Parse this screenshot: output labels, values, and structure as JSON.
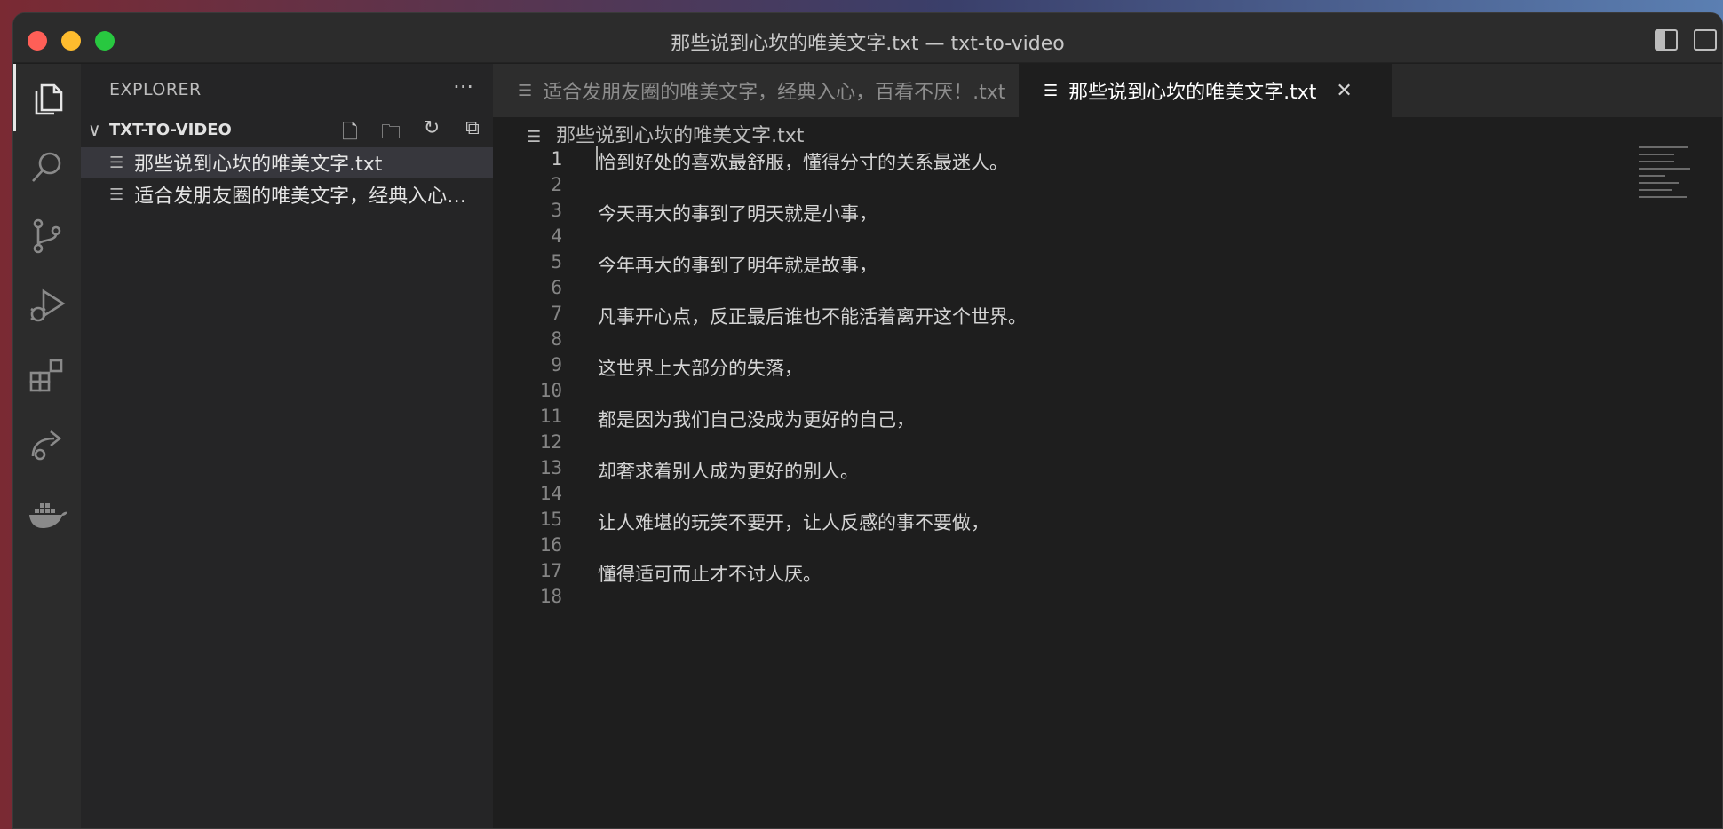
{
  "window": {
    "title": "那些说到心坎的唯美文字.txt — txt-to-video"
  },
  "activity_bar": {
    "items": [
      {
        "name": "explorer-icon",
        "active": true
      },
      {
        "name": "search-icon",
        "active": false
      },
      {
        "name": "source-control-icon",
        "active": false
      },
      {
        "name": "run-debug-icon",
        "active": false
      },
      {
        "name": "extensions-icon",
        "active": false
      },
      {
        "name": "remote-live-share-icon",
        "active": false
      },
      {
        "name": "docker-icon",
        "active": false
      }
    ]
  },
  "sidebar": {
    "header": "EXPLORER",
    "more": "···",
    "folder": {
      "name": "TXT-TO-VIDEO",
      "chevron": "∨",
      "actions": [
        "new-file-icon",
        "new-folder-icon",
        "refresh-icon",
        "collapse-all-icon"
      ]
    },
    "files": [
      {
        "label": "那些说到心坎的唯美文字.txt",
        "selected": true
      },
      {
        "label": "适合发朋友圈的唯美文字，经典入心，百看不厌！.txt",
        "selected": false
      }
    ]
  },
  "tabs": [
    {
      "label": "适合发朋友圈的唯美文字，经典入心，百看不厌！.txt",
      "active": false
    },
    {
      "label": "那些说到心坎的唯美文字.txt",
      "active": true,
      "close": "✕"
    }
  ],
  "breadcrumb": {
    "file": "那些说到心坎的唯美文字.txt"
  },
  "editor": {
    "current_line": 1,
    "lines": [
      {
        "n": "1",
        "text": "恰到好处的喜欢最舒服，懂得分寸的关系最迷人。"
      },
      {
        "n": "2",
        "text": ""
      },
      {
        "n": "3",
        "text": "今天再大的事到了明天就是小事，"
      },
      {
        "n": "4",
        "text": ""
      },
      {
        "n": "5",
        "text": "今年再大的事到了明年就是故事，"
      },
      {
        "n": "6",
        "text": ""
      },
      {
        "n": "7",
        "text": "凡事开心点，反正最后谁也不能活着离开这个世界。"
      },
      {
        "n": "8",
        "text": ""
      },
      {
        "n": "9",
        "text": "这世界上大部分的失落，"
      },
      {
        "n": "10",
        "text": ""
      },
      {
        "n": "11",
        "text": "都是因为我们自己没成为更好的自己，"
      },
      {
        "n": "12",
        "text": ""
      },
      {
        "n": "13",
        "text": "却奢求着别人成为更好的别人。"
      },
      {
        "n": "14",
        "text": ""
      },
      {
        "n": "15",
        "text": "让人难堪的玩笑不要开，让人反感的事不要做，"
      },
      {
        "n": "16",
        "text": ""
      },
      {
        "n": "17",
        "text": "懂得适可而止才不讨人厌。"
      },
      {
        "n": "18",
        "text": ""
      }
    ]
  },
  "colors": {
    "editor_bg": "#1e1e1e",
    "sidebar_bg": "#252526",
    "activity_bg": "#2c2c2c",
    "text": "#d4d4d4",
    "line_number": "#858585"
  }
}
